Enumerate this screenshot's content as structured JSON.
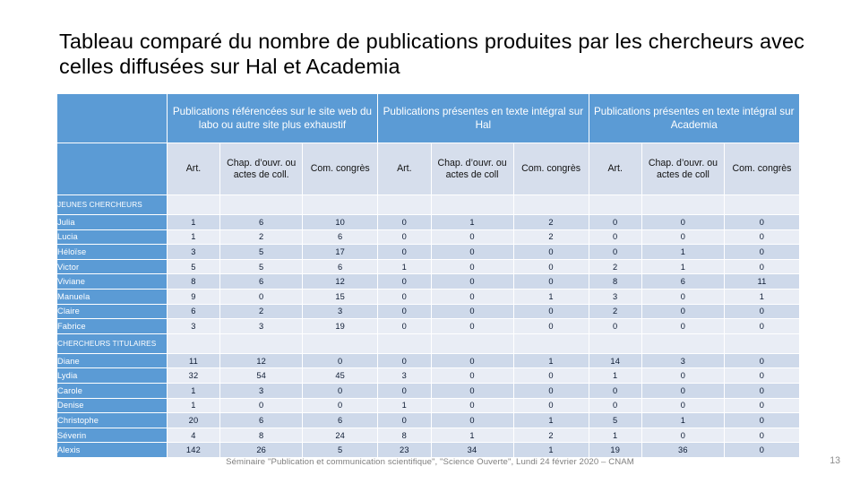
{
  "slide": {
    "title": "Tableau comparé du nombre de publications produites par les chercheurs avec celles diffusées sur Hal et Academia",
    "footer": "Séminaire \"Publication et communication scientifique\", \"Science Ouverte\", Lundi 24 février 2020 – CNAM",
    "page_number": "13"
  },
  "colors": {
    "header_blue": "#5B9BD5",
    "subheader_blue": "#D6DEEC",
    "band_dark": "#CED9EA",
    "band_light": "#E9EDF5",
    "title_text": "#000000",
    "footer_text": "#7f7f7f"
  },
  "table": {
    "corner_label": "",
    "group_headers": [
      "Publications référencées sur le site web du labo ou autre site plus exhaustif",
      "Publications présentes en texte intégral sur Hal",
      "Publications présentes en texte intégral sur Academia"
    ],
    "sub_headers": [
      "Art.",
      "Chap. d’ouvr. ou actes de coll.",
      "Com. congrès",
      "Art.",
      "Chap. d’ouvr. ou actes de coll",
      "Com. congrès",
      "Art.",
      "Chap. d’ouvr. ou actes de coll",
      "Com. congrès"
    ],
    "categories": [
      {
        "label": "JEUNES CHERCHEURS",
        "rows": [
          {
            "name": "Julia",
            "values": [
              "1",
              "6",
              "10",
              "0",
              "1",
              "2",
              "0",
              "0",
              "0"
            ]
          },
          {
            "name": "Lucia",
            "values": [
              "1",
              "2",
              "6",
              "0",
              "0",
              "2",
              "0",
              "0",
              "0"
            ]
          },
          {
            "name": "Héloïse",
            "values": [
              "3",
              "5",
              "17",
              "0",
              "0",
              "0",
              "0",
              "1",
              "0"
            ]
          },
          {
            "name": "Victor",
            "values": [
              "5",
              "5",
              "6",
              "1",
              "0",
              "0",
              "2",
              "1",
              "0"
            ]
          },
          {
            "name": "Viviane",
            "values": [
              "8",
              "6",
              "12",
              "0",
              "0",
              "0",
              "8",
              "6",
              "11"
            ]
          },
          {
            "name": "Manuela",
            "values": [
              "9",
              "0",
              "15",
              "0",
              "0",
              "1",
              "3",
              "0",
              "1"
            ]
          },
          {
            "name": "Claire",
            "values": [
              "6",
              "2",
              "3",
              "0",
              "0",
              "0",
              "2",
              "0",
              "0"
            ]
          },
          {
            "name": "Fabrice",
            "values": [
              "3",
              "3",
              "19",
              "0",
              "0",
              "0",
              "0",
              "0",
              "0"
            ]
          }
        ]
      },
      {
        "label": "CHERCHEURS TITULAIRES",
        "rows": [
          {
            "name": "Diane",
            "values": [
              "11",
              "12",
              "0",
              "0",
              "0",
              "1",
              "14",
              "3",
              "0"
            ]
          },
          {
            "name": "Lydia",
            "values": [
              "32",
              "54",
              "45",
              "3",
              "0",
              "0",
              "1",
              "0",
              "0"
            ]
          },
          {
            "name": "Carole",
            "values": [
              "1",
              "3",
              "0",
              "0",
              "0",
              "0",
              "0",
              "0",
              "0"
            ]
          },
          {
            "name": "Denise",
            "values": [
              "1",
              "0",
              "0",
              "1",
              "0",
              "0",
              "0",
              "0",
              "0"
            ]
          },
          {
            "name": "Christophe",
            "values": [
              "20",
              "6",
              "6",
              "0",
              "0",
              "1",
              "5",
              "1",
              "0"
            ]
          },
          {
            "name": "Séverin",
            "values": [
              "4",
              "8",
              "24",
              "8",
              "1",
              "2",
              "1",
              "0",
              "0"
            ]
          },
          {
            "name": "Alexis",
            "values": [
              "142",
              "26",
              "5",
              "23",
              "34",
              "1",
              "19",
              "36",
              "0"
            ]
          }
        ]
      }
    ]
  }
}
